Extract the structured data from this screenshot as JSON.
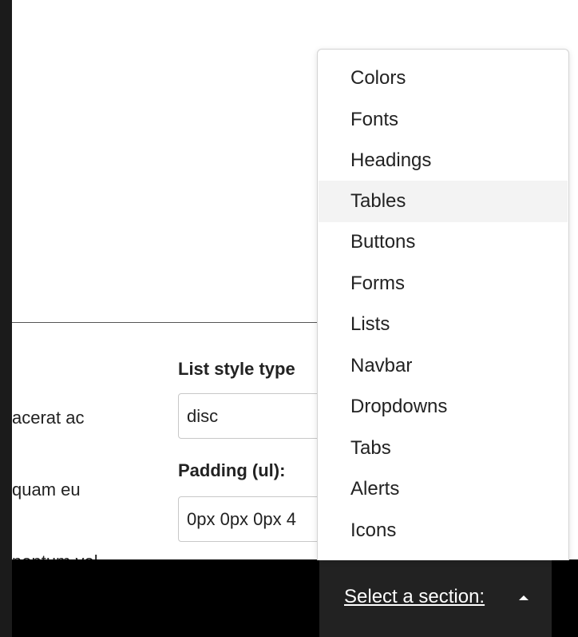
{
  "body_text": {
    "lines": [
      "acerat ac",
      "quam eu",
      "nentum vel."
    ]
  },
  "form": {
    "list_style_label": "List style type",
    "list_style_value": "disc",
    "padding_label": "Padding (ul):",
    "padding_value": "0px 0px 0px 4"
  },
  "dropdown": {
    "items": [
      {
        "label": "Colors",
        "active": false
      },
      {
        "label": "Fonts",
        "active": false
      },
      {
        "label": "Headings",
        "active": false
      },
      {
        "label": "Tables",
        "active": true
      },
      {
        "label": "Buttons",
        "active": false
      },
      {
        "label": "Forms",
        "active": false
      },
      {
        "label": "Lists",
        "active": false
      },
      {
        "label": "Navbar",
        "active": false
      },
      {
        "label": "Dropdowns",
        "active": false
      },
      {
        "label": "Tabs",
        "active": false
      },
      {
        "label": "Alerts",
        "active": false
      },
      {
        "label": "Icons",
        "active": false
      }
    ]
  },
  "section_select": {
    "label": "Select a section:",
    "caret_icon": "caret-up-icon"
  },
  "colors": {
    "left_bar": "#1b1b1b",
    "bottom_bar": "#000000",
    "select_button": "#222222",
    "active_item": "#f3f3f3"
  }
}
